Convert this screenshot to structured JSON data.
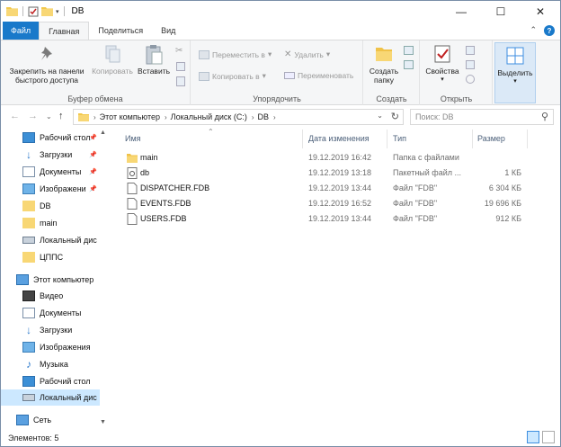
{
  "window": {
    "title": "DB",
    "controls": [
      "—",
      "☐",
      "✕"
    ]
  },
  "ribbon_tabs": [
    {
      "label": "Файл"
    },
    {
      "label": "Главная"
    },
    {
      "label": "Поделиться"
    },
    {
      "label": "Вид"
    }
  ],
  "ribbon": {
    "clipboard": {
      "pin_label": "Закрепить на панели быстрого доступа",
      "copy_label": "Копировать",
      "paste_label": "Вставить",
      "group_label": "Буфер обмена"
    },
    "organize": {
      "move_label": "Переместить в",
      "copy_to_label": "Копировать в",
      "delete_label": "Удалить",
      "rename_label": "Переименовать",
      "group_label": "Упорядочить"
    },
    "create": {
      "new_folder_label": "Создать папку",
      "group_label": "Создать"
    },
    "open": {
      "properties_label": "Свойства",
      "group_label": "Открыть"
    },
    "select": {
      "select_label": "Выделить"
    }
  },
  "address": {
    "crumbs": [
      "Этот компьютер",
      "Локальный диск (C:)",
      "DB"
    ],
    "search_placeholder": "Поиск: DB"
  },
  "nav": {
    "items": [
      {
        "label": "Рабочий стол",
        "pinned": true,
        "icon": "desktop-icon"
      },
      {
        "label": "Загрузки",
        "pinned": true,
        "icon": "download-icon"
      },
      {
        "label": "Документы",
        "pinned": true,
        "icon": "documents-icon"
      },
      {
        "label": "Изображени",
        "pinned": true,
        "icon": "pictures-icon"
      },
      {
        "label": "DB",
        "pinned": false,
        "icon": "folder-icon"
      },
      {
        "label": "main",
        "pinned": false,
        "icon": "folder-icon"
      },
      {
        "label": "Локальный дис",
        "pinned": false,
        "icon": "drive-icon"
      },
      {
        "label": "ЦППС",
        "pinned": false,
        "icon": "folder-icon"
      }
    ],
    "this_pc": "Этот компьютер",
    "pc_items": [
      {
        "label": "Видео",
        "icon": "video-icon"
      },
      {
        "label": "Документы",
        "icon": "documents-icon"
      },
      {
        "label": "Загрузки",
        "icon": "download-icon"
      },
      {
        "label": "Изображения",
        "icon": "pictures-icon"
      },
      {
        "label": "Музыка",
        "icon": "music-icon"
      },
      {
        "label": "Рабочий стол",
        "icon": "desktop-icon"
      },
      {
        "label": "Локальный дис",
        "icon": "drive-icon"
      }
    ],
    "network": "Сеть"
  },
  "columns": {
    "name": "Имя",
    "date": "Дата изменения",
    "type": "Тип",
    "size": "Размер"
  },
  "files": [
    {
      "name": "main",
      "date": "19.12.2019 16:42",
      "type": "Папка с файлами",
      "size": "",
      "icon": "folder-icon"
    },
    {
      "name": "db",
      "date": "19.12.2019 13:18",
      "type": "Пакетный файл ...",
      "size": "1 КБ",
      "icon": "batch-file-icon"
    },
    {
      "name": "DISPATCHER.FDB",
      "date": "19.12.2019 13:44",
      "type": "Файл \"FDB\"",
      "size": "6 304 КБ",
      "icon": "file-icon"
    },
    {
      "name": "EVENTS.FDB",
      "date": "19.12.2019 16:52",
      "type": "Файл \"FDB\"",
      "size": "19 696 КБ",
      "icon": "file-icon"
    },
    {
      "name": "USERS.FDB",
      "date": "19.12.2019 13:44",
      "type": "Файл \"FDB\"",
      "size": "912 КБ",
      "icon": "file-icon"
    }
  ],
  "status": {
    "items_count": "Элементов: 5"
  }
}
